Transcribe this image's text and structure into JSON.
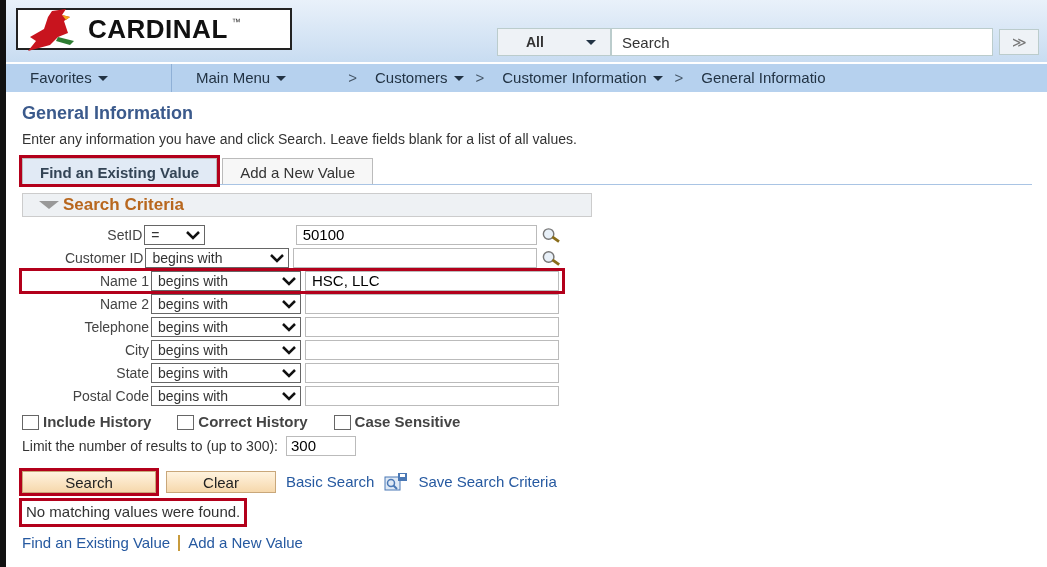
{
  "header": {
    "logo_text": "CARDINAL",
    "trademark": "™",
    "search_scope": "All",
    "search": {
      "placeholder": "Search"
    },
    "search_button": "≫"
  },
  "nav": [
    {
      "label": "Favorites",
      "kind": "menu",
      "dropdown": true
    },
    {
      "label": "Main Menu",
      "kind": "menu",
      "dropdown": true
    },
    {
      "label": "Customers",
      "kind": "crumb",
      "prefix": ">",
      "dropdown": true
    },
    {
      "label": "Customer Information",
      "kind": "crumb",
      "prefix": ">",
      "dropdown": true
    },
    {
      "label": "General Informatio",
      "kind": "crumb",
      "prefix": ">",
      "dropdown": false
    }
  ],
  "page": {
    "title": "General Information",
    "instructions": "Enter any information you have and click Search. Leave fields blank for a list of all values."
  },
  "tabs": [
    {
      "label": "Find an Existing Value",
      "selected": true,
      "highlighted": true
    },
    {
      "label": "Add a New Value",
      "selected": false,
      "highlighted": false
    }
  ],
  "section": {
    "title": "Search Criteria",
    "expanded": true
  },
  "criteria": [
    {
      "label": "SetID",
      "operator": "=",
      "value": "50100",
      "lookup": true,
      "highlighted": false
    },
    {
      "label": "Customer ID",
      "operator": "begins with",
      "lookup": true,
      "highlighted": false
    },
    {
      "label": "Name 1",
      "operator": "begins with",
      "value": "HSC, LLC",
      "lookup": false,
      "highlighted": true
    },
    {
      "label": "Name 2",
      "operator": "begins with",
      "lookup": false,
      "highlighted": false
    },
    {
      "label": "Telephone",
      "operator": "begins with",
      "lookup": false,
      "highlighted": false
    },
    {
      "label": "City",
      "operator": "begins with",
      "lookup": false,
      "highlighted": false
    },
    {
      "label": "State",
      "operator": "begins with",
      "lookup": false,
      "highlighted": false
    },
    {
      "label": "Postal Code",
      "operator": "begins with",
      "lookup": false,
      "highlighted": false
    }
  ],
  "options": [
    {
      "label": "Include History",
      "checked": false
    },
    {
      "label": "Correct History",
      "checked": false
    },
    {
      "label": "Case Sensitive",
      "checked": false
    }
  ],
  "limit": {
    "label": "Limit the number of results to (up to 300):",
    "value": "300"
  },
  "buttons": [
    {
      "label": "Search",
      "highlighted": true
    },
    {
      "label": "Clear",
      "highlighted": false
    }
  ],
  "links": [
    {
      "label": "Basic Search",
      "icon": false
    },
    {
      "label": "Save Search Criteria",
      "icon": true
    }
  ],
  "message": {
    "text": "No matching values were found.",
    "highlighted": true
  },
  "footer_links": [
    {
      "label": "Find an Existing Value"
    },
    {
      "label": "Add a New Value"
    }
  ]
}
